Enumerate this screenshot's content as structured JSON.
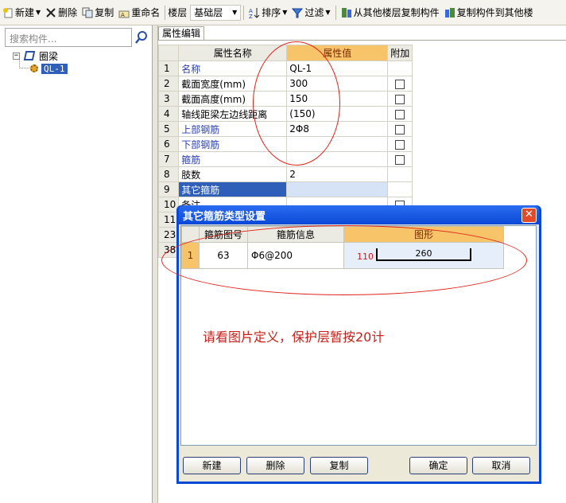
{
  "toolbar": {
    "new_label": "新建",
    "delete_label": "删除",
    "copy_label": "复制",
    "rename_label": "重命名",
    "floor_label": "楼层",
    "floor_value": "基础层",
    "sort_label": "排序",
    "filter_label": "过滤",
    "copy_from_floor_label": "从其他楼层复制构件",
    "copy_to_floor_label": "复制构件到其他楼"
  },
  "left_pane": {
    "search_placeholder": "搜索构件...",
    "tree": {
      "root_label": "圈梁",
      "root_expander": "−",
      "child_label": "QL-1"
    }
  },
  "property_editor": {
    "tab_label": "属性编辑",
    "headers": {
      "name": "属性名称",
      "value": "属性值",
      "extra": "附加"
    },
    "rows": [
      {
        "num": "1",
        "name": "名称",
        "value": "QL-1",
        "blue": true,
        "checkbox": false
      },
      {
        "num": "2",
        "name": "截面宽度(mm)",
        "value": "300",
        "blue": false,
        "checkbox": true
      },
      {
        "num": "3",
        "name": "截面高度(mm)",
        "value": "150",
        "blue": false,
        "checkbox": true
      },
      {
        "num": "4",
        "name": "轴线距梁左边线距离",
        "value": "(150)",
        "blue": false,
        "checkbox": true
      },
      {
        "num": "5",
        "name": "上部钢筋",
        "value": "2Φ8",
        "blue": true,
        "checkbox": true
      },
      {
        "num": "6",
        "name": "下部钢筋",
        "value": "",
        "blue": true,
        "checkbox": true
      },
      {
        "num": "7",
        "name": "箍筋",
        "value": "",
        "blue": true,
        "checkbox": true
      },
      {
        "num": "8",
        "name": "肢数",
        "value": "2",
        "blue": false,
        "checkbox": false
      },
      {
        "num": "9",
        "name": "其它箍筋",
        "value": "",
        "blue": false,
        "checkbox": false,
        "selected": true
      },
      {
        "num": "10",
        "name": "备注",
        "value": "",
        "blue": false,
        "checkbox": true
      },
      {
        "num": "11",
        "name": "",
        "value": "",
        "blue": false,
        "checkbox": false
      },
      {
        "num": "23",
        "name": "",
        "value": "",
        "blue": false,
        "checkbox": false
      },
      {
        "num": "38",
        "name": "",
        "value": "",
        "blue": false,
        "checkbox": false
      }
    ]
  },
  "dialog": {
    "title": "其它箍筋类型设置",
    "close_symbol": "✕",
    "headers": {
      "fig_no": "箍筋图号",
      "info": "箍筋信息",
      "shape": "图形"
    },
    "row": {
      "num": "1",
      "fig_no": "63",
      "info": "Φ6@200",
      "shape_left": "110",
      "shape_length": "260"
    },
    "note": "请看图片定义，保护层暂按20计",
    "buttons": {
      "new": "新建",
      "delete": "删除",
      "copy": "复制",
      "ok": "确定",
      "cancel": "取消"
    }
  },
  "colors": {
    "accent_blue": "#0a49d6",
    "header_orange": "#f7c46a",
    "annotation_red": "#e0241a",
    "selection_blue": "#2f5fb8"
  }
}
